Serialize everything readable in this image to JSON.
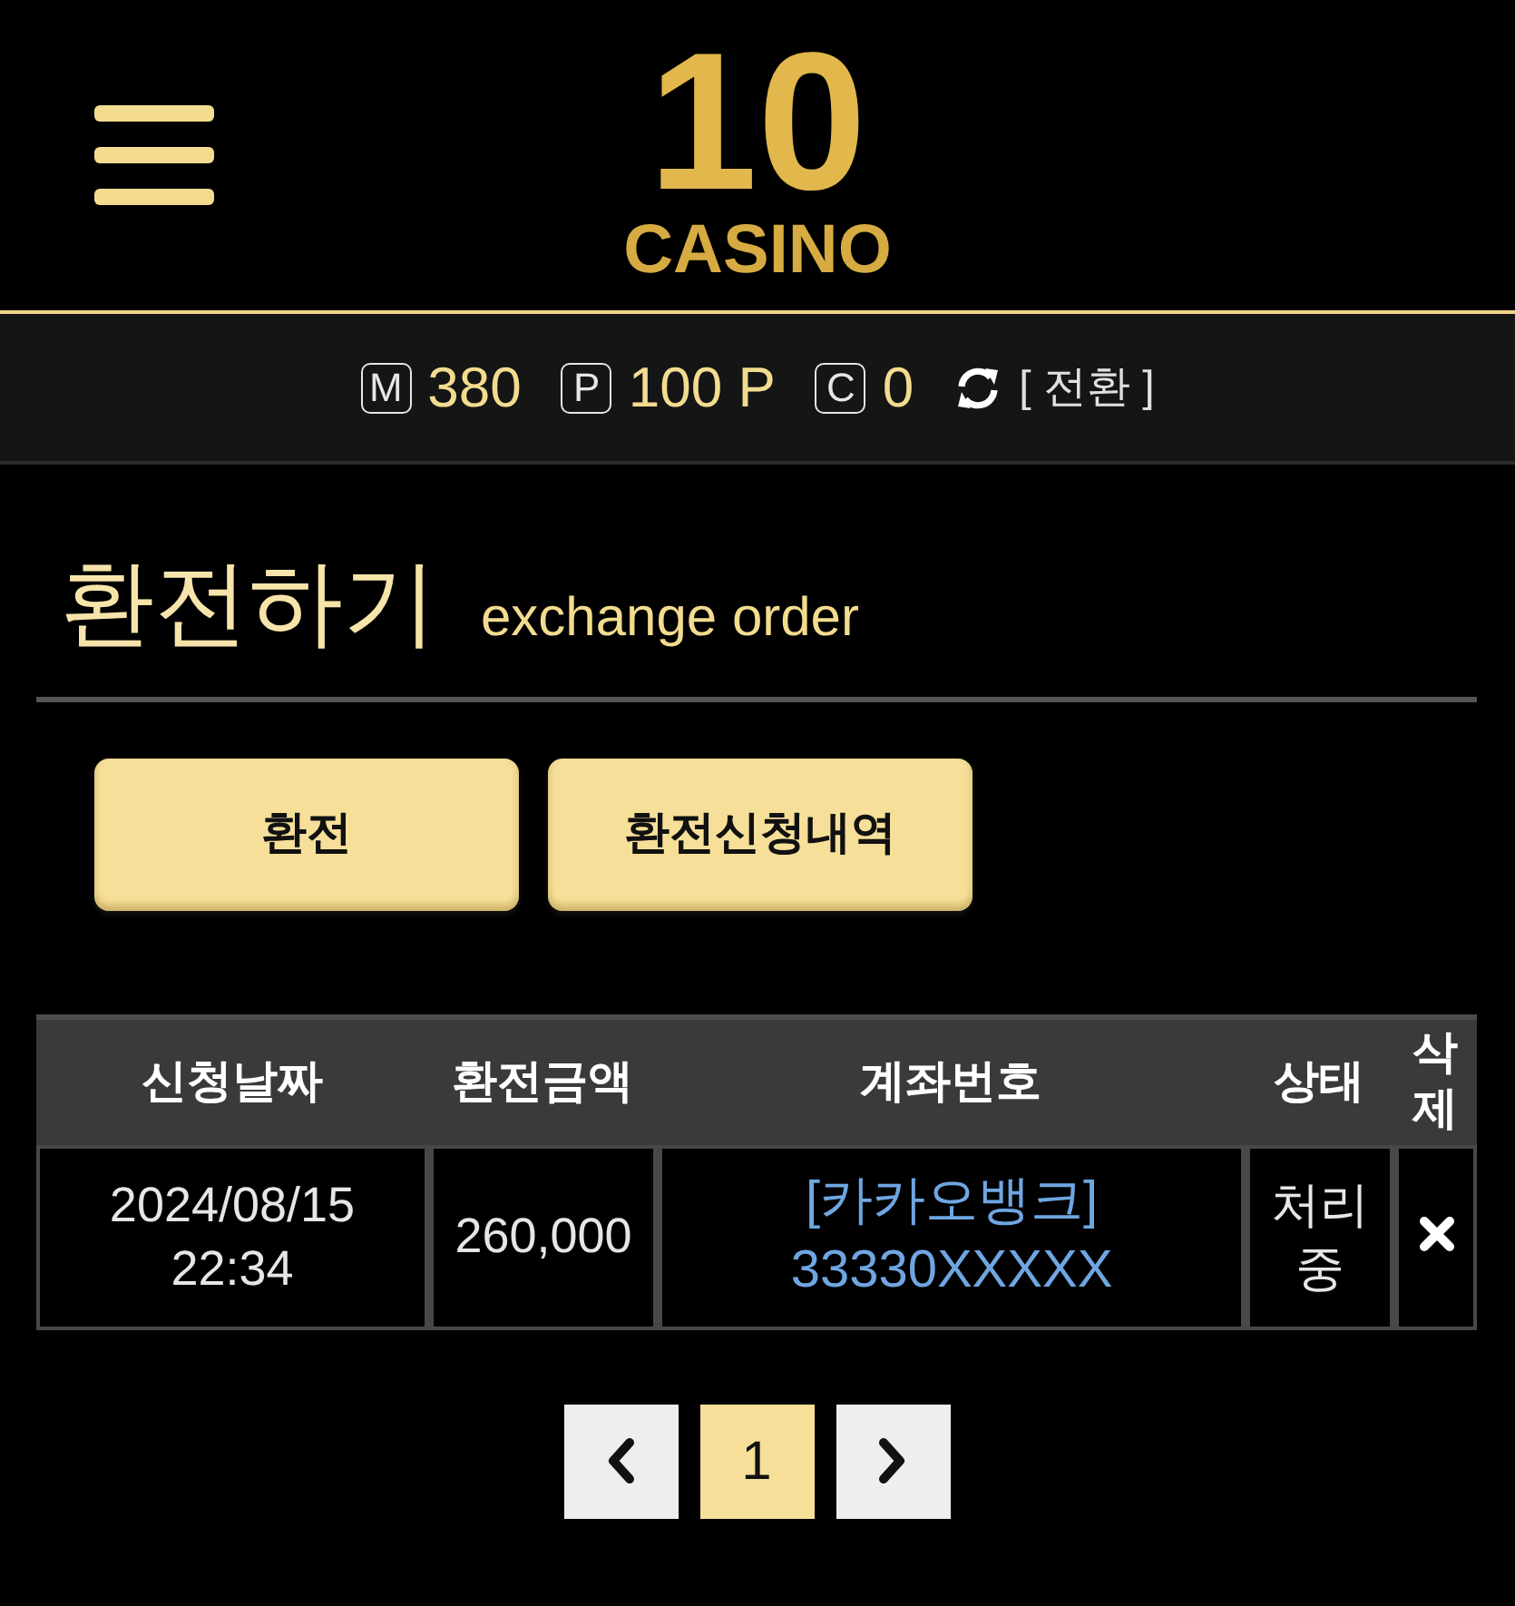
{
  "header": {
    "logo": {
      "number": "10",
      "wordmark": "CASINO"
    }
  },
  "balances": [
    {
      "symbol": "M",
      "value": "380"
    },
    {
      "symbol": "P",
      "value": "100 P"
    },
    {
      "symbol": "C",
      "value": "0"
    }
  ],
  "convert_link": "[ 전환 ]",
  "page_title": {
    "title": "환전하기",
    "subtitle": "exchange order"
  },
  "actions": [
    {
      "label": "환전"
    },
    {
      "label": "환전신청내역"
    }
  ],
  "table": {
    "columns": [
      "신청날짜",
      "환전금액",
      "계좌번호",
      "상태",
      "삭제"
    ],
    "rows": [
      {
        "date": "2024/08/15",
        "time": "22:34",
        "amount": "260,000",
        "bank": "[카카오뱅크]",
        "account_number": "33330XXXXX",
        "status": "처리중"
      }
    ]
  },
  "pagination": {
    "pages": [
      {
        "label": "1",
        "selected": true
      }
    ]
  }
}
